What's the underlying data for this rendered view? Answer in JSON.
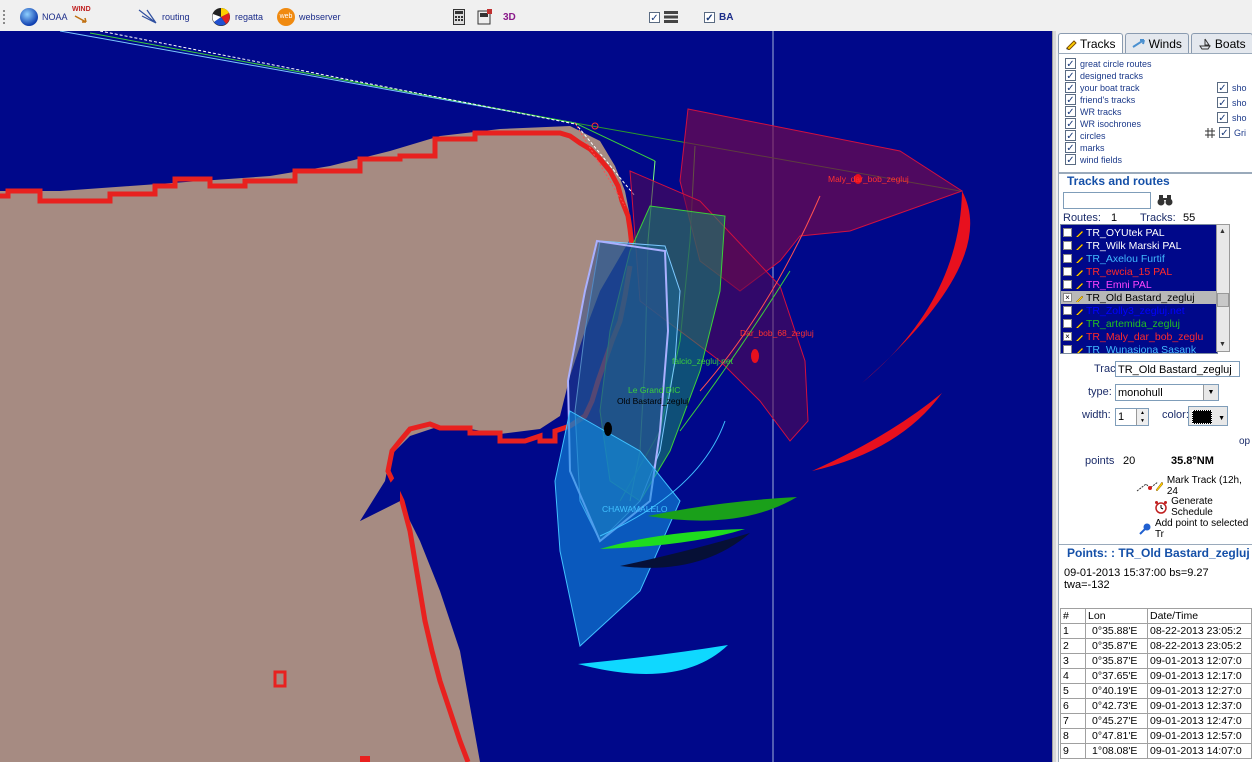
{
  "toolbar": {
    "noaa": "NOAA",
    "wind": "WIND",
    "routing": "routing",
    "regatta": "regatta",
    "web_badge": "web",
    "webserver": "webserver",
    "three_d": "3D",
    "ba": "BA"
  },
  "map": {
    "boat_labels": [
      "Maly_dar_bob_zegluj",
      "Dar_bob_68_zegluj",
      "falcio_zegluj.net",
      "Le Grand DIC",
      "Old Bastard_zegluj",
      "CHAWAMALELO"
    ]
  },
  "panel": {
    "tabs": [
      "Tracks",
      "Winds",
      "Boats"
    ],
    "layers": [
      "great circle routes",
      "designed  tracks",
      "your boat track",
      "friend's tracks",
      "WR tracks",
      "WR isochrones",
      "circles",
      "marks",
      "wind fields"
    ],
    "right_checks": [
      "sho",
      "sho",
      "sho",
      "Gri"
    ],
    "tracks_title": "Tracks and routes",
    "routes_label": "Routes:",
    "routes_count": "1",
    "tracks_label": "Tracks:",
    "tracks_count": "55",
    "track_list": [
      {
        "name": "TR_OYUtek PAL",
        "color": "#ffffff",
        "checked": false
      },
      {
        "name": "TR_Wilk Marski PAL",
        "color": "#ffffff",
        "checked": false
      },
      {
        "name": "TR_Axelou Furtif",
        "color": "#41b9ff",
        "checked": false
      },
      {
        "name": "TR_ewcia_15 PAL",
        "color": "#ff2a2a",
        "checked": false
      },
      {
        "name": "TR_Emni PAL",
        "color": "#ff44ff",
        "checked": false
      },
      {
        "name": "TR_Old Bastard_zegluj",
        "color": "#000000",
        "checked": true,
        "selected": true
      },
      {
        "name": "TR_Zolly3_zegluj.net",
        "color": "#0000ff",
        "checked": false
      },
      {
        "name": "TR_artemida_zegluj",
        "color": "#22c022",
        "checked": false
      },
      {
        "name": "TR_Maly_dar_bob_zeglu",
        "color": "#ff2a2a",
        "checked": true
      },
      {
        "name": "TR_Wunasiona Sasank",
        "color": "#41b9ff",
        "checked": false
      }
    ],
    "track_label": "Track:",
    "track_value": "TR_Old Bastard_zegluj",
    "type_label": "type:",
    "type_value": "monohull",
    "width_label": "width:",
    "width_value": "1",
    "color_label": "color:",
    "op_label": "op",
    "points_label": "points",
    "points_value": "20",
    "distance": "35.8°NM",
    "mark_track": "Mark Track (12h, 24",
    "generate_schedule": "Generate Schedule",
    "add_point": "Add point to selected Tr",
    "points_title": "Points: : TR_Old Bastard_zegluj",
    "status_line": "09-01-2013 15:37:00 bs=9.27 twa=-132",
    "table_headers": [
      "#",
      "Lon",
      "Date/Time"
    ],
    "table_rows": [
      [
        "1",
        "0°35.88'E",
        "08-22-2013 23:05:2"
      ],
      [
        "2",
        "0°35.87'E",
        "08-22-2013 23:05:2"
      ],
      [
        "3",
        "0°35.87'E",
        "09-01-2013 12:07:0"
      ],
      [
        "4",
        "0°37.65'E",
        "09-01-2013 12:17:0"
      ],
      [
        "5",
        "0°40.19'E",
        "09-01-2013 12:27:0"
      ],
      [
        "6",
        "0°42.73'E",
        "09-01-2013 12:37:0"
      ],
      [
        "7",
        "0°45.27'E",
        "09-01-2013 12:47:0"
      ],
      [
        "8",
        "0°47.81'E",
        "09-01-2013 12:57:0"
      ],
      [
        "9",
        "1°08.08'E",
        "09-01-2013 14:07:0"
      ]
    ]
  },
  "colors": {
    "sea": "#00088a",
    "land": "#a68b82",
    "coastline": "#e8211f",
    "title_blue": "#1550a8"
  }
}
